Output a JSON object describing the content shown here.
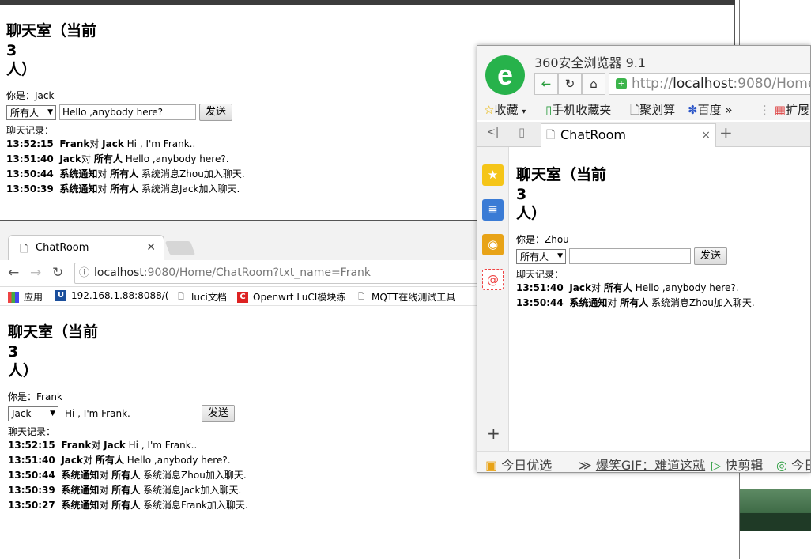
{
  "jack_window": {
    "title_line1": "聊天室（当前",
    "title_count": "3",
    "title_line3": "人）",
    "you_are": "你是：Jack",
    "recipient": "所有人",
    "message_value": "Hello ,anybody here?",
    "send_label": "发送",
    "history_label": "聊天记录：",
    "messages": [
      {
        "time": "13:52:15",
        "from": "Frank",
        "verb": "对",
        "to": "Jack",
        "text": "Hi , I'm Frank.."
      },
      {
        "time": "13:51:40",
        "from": "Jack",
        "verb": "对",
        "to": "所有人",
        "text": "Hello ,anybody here?."
      },
      {
        "time": "13:50:44",
        "from": "系统通知",
        "verb": "对",
        "to": "所有人",
        "text": "系统消息Zhou加入聊天."
      },
      {
        "time": "13:50:39",
        "from": "系统通知",
        "verb": "对",
        "to": "所有人",
        "text": "系统消息Jack加入聊天."
      }
    ]
  },
  "frank_browser": {
    "tab_title": "ChatRoom",
    "url_host": "localhost",
    "url_rest": ":9080/Home/ChatRoom?txt_name=Frank",
    "bookmarks": [
      {
        "icon": "apps-grid-icon",
        "label": "应用"
      },
      {
        "icon": "u-icon",
        "label": "192.168.1.88:8088/("
      },
      {
        "icon": "doc-icon",
        "label": "luci文档"
      },
      {
        "icon": "c-icon",
        "label": "Openwrt LuCI模块练"
      },
      {
        "icon": "doc-icon",
        "label": "MQTT在线测试工具"
      }
    ],
    "title_line1": "聊天室（当前",
    "title_count": "3",
    "title_line3": "人）",
    "you_are": "你是：Frank",
    "recipient": "Jack",
    "message_value": "Hi , I'm Frank.",
    "send_label": "发送",
    "history_label": "聊天记录：",
    "messages": [
      {
        "time": "13:52:15",
        "from": "Frank",
        "verb": "对",
        "to": "Jack",
        "text": "Hi , I'm Frank.."
      },
      {
        "time": "13:51:40",
        "from": "Jack",
        "verb": "对",
        "to": "所有人",
        "text": "Hello ,anybody here?."
      },
      {
        "time": "13:50:44",
        "from": "系统通知",
        "verb": "对",
        "to": "所有人",
        "text": "系统消息Zhou加入聊天."
      },
      {
        "time": "13:50:39",
        "from": "系统通知",
        "verb": "对",
        "to": "所有人",
        "text": "系统消息Jack加入聊天."
      },
      {
        "time": "13:50:27",
        "from": "系统通知",
        "verb": "对",
        "to": "所有人",
        "text": "系统消息Frank加入聊天."
      }
    ]
  },
  "zhou_browser": {
    "app_name": "360安全浏览器 9.1",
    "url_prefix": "http://",
    "url_host": "localhost",
    "url_rest": ":9080/Home/",
    "bookmarks": [
      "收藏",
      "手机收藏夹",
      "聚划算",
      "百度",
      "扩展"
    ],
    "tab_title": "ChatRoom",
    "title_line1": "聊天室（当前",
    "title_count": "3",
    "title_line3": "人）",
    "you_are": "你是：Zhou",
    "recipient": "所有人",
    "message_value": "",
    "send_label": "发送",
    "history_label": "聊天记录：",
    "messages": [
      {
        "time": "13:51:40",
        "from": "Jack",
        "verb": "对",
        "to": "所有人",
        "text": "Hello ,anybody here?."
      },
      {
        "time": "13:50:44",
        "from": "系统通知",
        "verb": "对",
        "to": "所有人",
        "text": "系统消息Zhou加入聊天."
      }
    ],
    "status_items": [
      "今日优选",
      "爆笑GIF：难道这就",
      "快剪辑",
      "今日"
    ]
  }
}
